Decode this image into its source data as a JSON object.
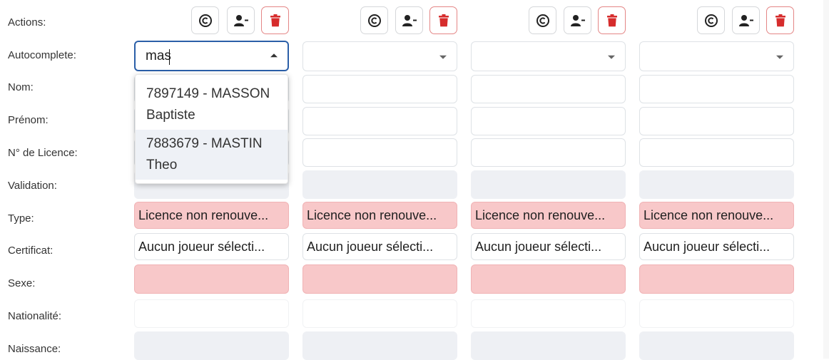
{
  "labels": {
    "actions": "Actions:",
    "autocomplete": "Autocomplete:",
    "nom": "Nom:",
    "prenom": "Prénom:",
    "licence": "N° de Licence:",
    "validation": "Validation:",
    "type": "Type:",
    "certificat": "Certificat:",
    "sexe": "Sexe:",
    "nationalite": "Nationalité:",
    "naissance": "Naissance:"
  },
  "icons": {
    "copyright": "copyright-icon",
    "remove_user": "user-minus-icon",
    "delete": "trash-icon",
    "caret": "caret-down-icon"
  },
  "colors": {
    "focus_border": "#2b5fa8",
    "danger": "#d62c2c",
    "error_bg": "#f8c8c9",
    "disabled_bg": "#eef0f4"
  },
  "columns": [
    {
      "autocomplete_value": "mas",
      "type": "Licence non renouve...",
      "certificat": "Aucun joueur sélecti..."
    },
    {
      "autocomplete_value": "",
      "type": "Licence non renouve...",
      "certificat": "Aucun joueur sélecti..."
    },
    {
      "autocomplete_value": "",
      "type": "Licence non renouve...",
      "certificat": "Aucun joueur sélecti..."
    },
    {
      "autocomplete_value": "",
      "type": "Licence non renouve...",
      "certificat": "Aucun joueur sélecti..."
    }
  ],
  "dropdown": {
    "options": [
      {
        "line1": "7897149 - MASSON",
        "line2": "Baptiste"
      },
      {
        "line1": "7883679 - MASTIN",
        "line2": "Theo"
      }
    ]
  }
}
